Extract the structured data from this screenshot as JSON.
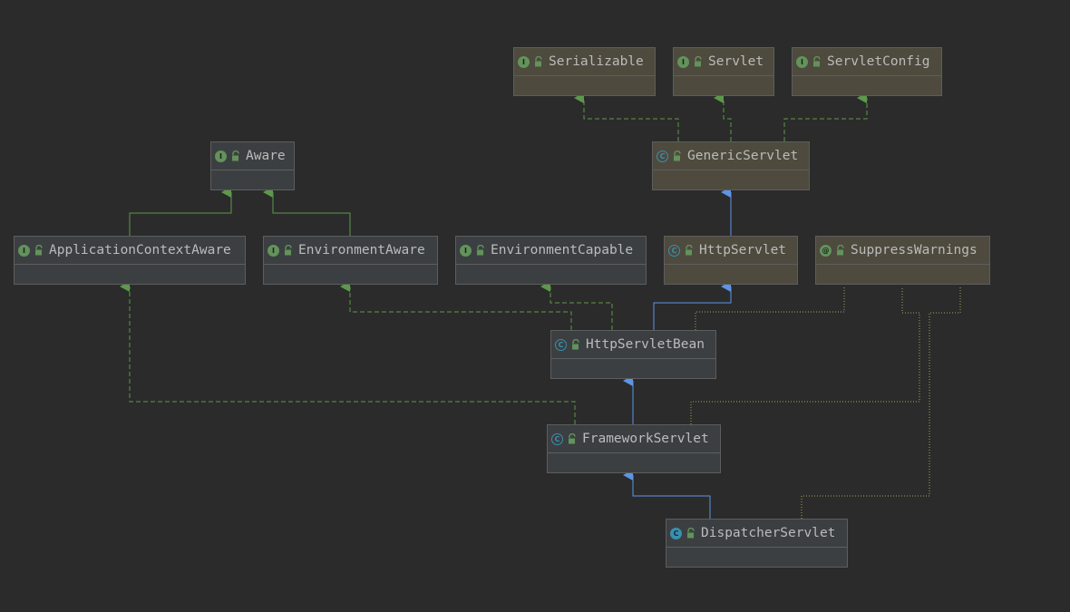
{
  "colors": {
    "background": "#2b2b2b",
    "library_node": "#4e4a3e",
    "project_node": "#3c3f41",
    "extends_edge": "#5e94e6",
    "implements_edge": "#5c9a4a",
    "annotation_edge": "#a8a05a",
    "interface_icon": "#62935b",
    "class_icon": "#3a8fae"
  },
  "nodes": {
    "serializable": {
      "label": "Serializable",
      "kind": "interface",
      "kind_icon": "I"
    },
    "servlet": {
      "label": "Servlet",
      "kind": "interface",
      "kind_icon": "I"
    },
    "servlet_config": {
      "label": "ServletConfig",
      "kind": "interface",
      "kind_icon": "I"
    },
    "generic_servlet": {
      "label": "GenericServlet",
      "kind": "abstract-class",
      "kind_icon": "C"
    },
    "aware": {
      "label": "Aware",
      "kind": "interface",
      "kind_icon": "I"
    },
    "application_context_aware": {
      "label": "ApplicationContextAware",
      "kind": "interface",
      "kind_icon": "I"
    },
    "environment_aware": {
      "label": "EnvironmentAware",
      "kind": "interface",
      "kind_icon": "I"
    },
    "environment_capable": {
      "label": "EnvironmentCapable",
      "kind": "interface",
      "kind_icon": "I"
    },
    "http_servlet": {
      "label": "HttpServlet",
      "kind": "abstract-class",
      "kind_icon": "C"
    },
    "suppress_warnings": {
      "label": "SuppressWarnings",
      "kind": "annotation",
      "kind_icon": "@"
    },
    "http_servlet_bean": {
      "label": "HttpServletBean",
      "kind": "abstract-class",
      "kind_icon": "C"
    },
    "framework_servlet": {
      "label": "FrameworkServlet",
      "kind": "abstract-class",
      "kind_icon": "C"
    },
    "dispatcher_servlet": {
      "label": "DispatcherServlet",
      "kind": "class",
      "kind_icon": "C"
    }
  }
}
